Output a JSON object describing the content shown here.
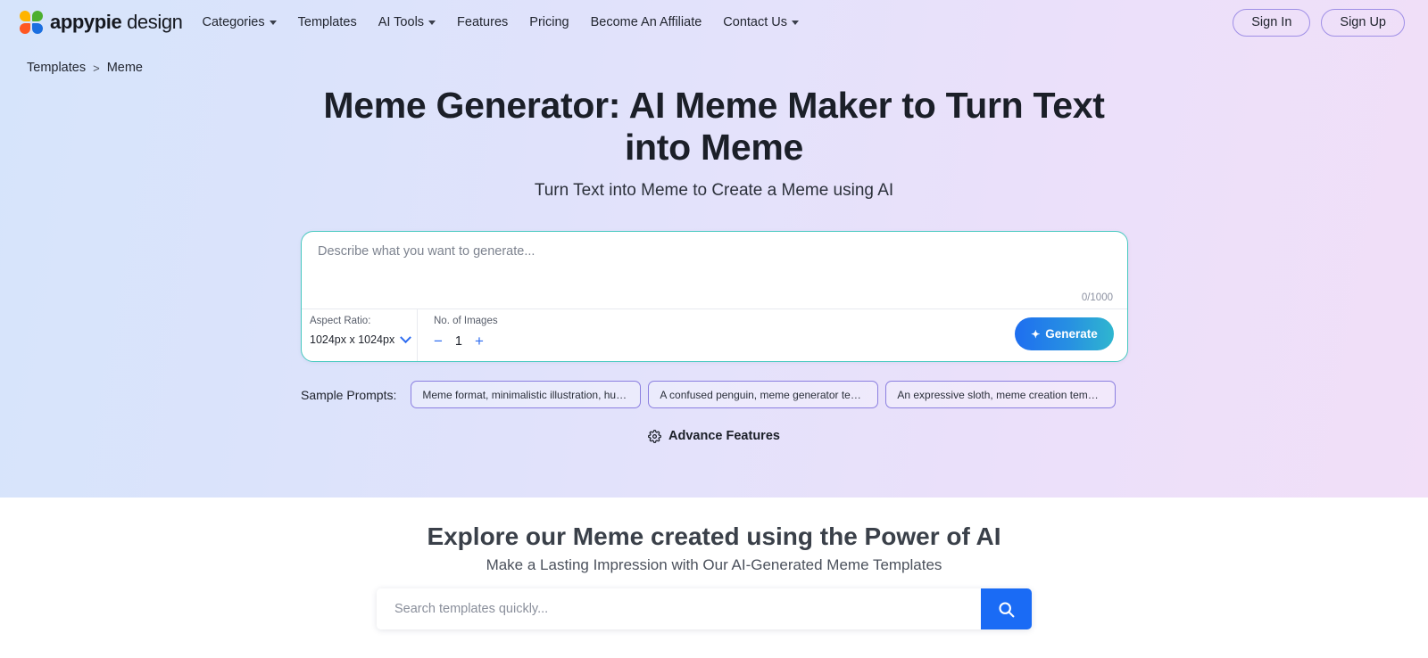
{
  "navbar": {
    "logo": {
      "bold": "appypie",
      "light": "design",
      "icon": "appypie-flower-logo"
    },
    "links": [
      {
        "label": "Categories",
        "has_caret": true
      },
      {
        "label": "Templates",
        "has_caret": false
      },
      {
        "label": "AI Tools",
        "has_caret": true
      },
      {
        "label": "Features",
        "has_caret": false
      },
      {
        "label": "Pricing",
        "has_caret": false
      },
      {
        "label": "Become An Affiliate",
        "has_caret": false
      },
      {
        "label": "Contact Us",
        "has_caret": true
      }
    ],
    "sign_in": "Sign In",
    "sign_up": "Sign Up"
  },
  "breadcrumb": {
    "parent": "Templates",
    "separator": ">",
    "current": "Meme"
  },
  "hero": {
    "title": "Meme Generator: AI Meme Maker to Turn Text into Meme",
    "subtitle": "Turn Text into Meme to Create a Meme using AI"
  },
  "generator": {
    "prompt_placeholder": "Describe what you want to generate...",
    "prompt_value": "",
    "char_count": "0/1000",
    "aspect_ratio_label": "Aspect Ratio:",
    "aspect_ratio_value": "1024px x 1024px",
    "num_images_label": "No. of Images",
    "num_images_value": "1",
    "decrement": "−",
    "increment": "+",
    "generate_label": "Generate",
    "generate_icon": "sparkle-icon",
    "accent_border": "#49c9c0",
    "generate_gradient_from": "#1e6ef0",
    "generate_gradient_to": "#2fb6cf"
  },
  "sample_prompts": {
    "label": "Sample Prompts:",
    "chips": [
      "Meme format, minimalistic illustration, humor, ...",
      "A confused penguin, meme generator templat...",
      "An expressive sloth, meme creation template, ..."
    ]
  },
  "advance_features": {
    "label": "Advance Features",
    "icon": "gear-icon"
  },
  "lower": {
    "title": "Explore our Meme created using the Power of AI",
    "subtitle": "Make a Lasting Impression with Our AI-Generated Meme Templates",
    "search_placeholder": "Search templates quickly...",
    "search_value": "",
    "search_icon": "search-icon",
    "search_button_color": "#1a6bf5"
  }
}
